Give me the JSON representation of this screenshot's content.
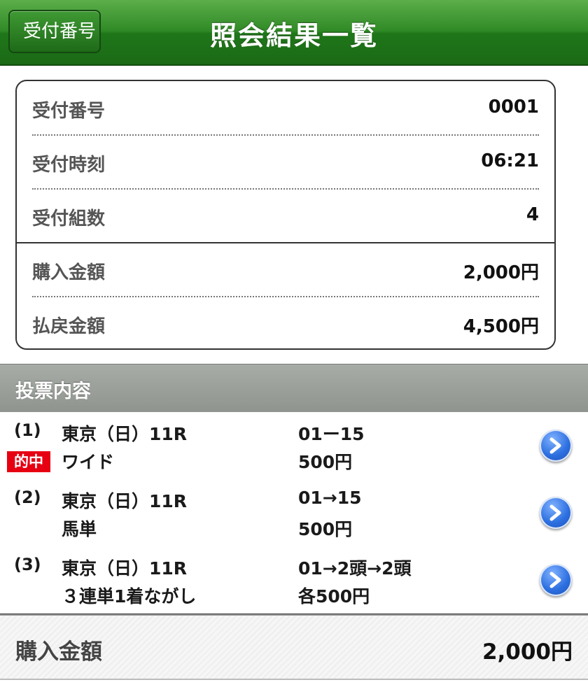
{
  "header": {
    "back_label": "受付番号",
    "title": "照会結果一覧"
  },
  "summary": [
    {
      "label": "受付番号",
      "value": "0001"
    },
    {
      "label": "受付時刻",
      "value": "06:21"
    },
    {
      "label": "受付組数",
      "value": "4"
    },
    {
      "label": "購入金額",
      "value": "2,000円"
    },
    {
      "label": "払戻金額",
      "value": "4,500円"
    }
  ],
  "section": {
    "title": "投票内容"
  },
  "bets": [
    {
      "num": "(1)",
      "place": "東京（日）11R",
      "type": "ワイド",
      "combo": "01ー15",
      "amount": "500円",
      "badge": "的中"
    },
    {
      "num": "(2)",
      "place": "東京（日）11R",
      "type": "馬単",
      "combo": "01→15",
      "amount": "500円"
    },
    {
      "num": "(3)",
      "place": "東京（日）11R",
      "type": "３連単1着ながし",
      "combo": "01→2頭→2頭",
      "amount": "各500円"
    }
  ],
  "footer": {
    "label": "購入金額",
    "value": "2,000円"
  },
  "icons": {
    "row_arrow": "chevron-right-circle-icon",
    "back": "back-arrow-icon"
  },
  "colors": {
    "header_green": "#2f8a26",
    "hit_red": "#e60012",
    "arrow_blue": "#2d6fe0"
  }
}
